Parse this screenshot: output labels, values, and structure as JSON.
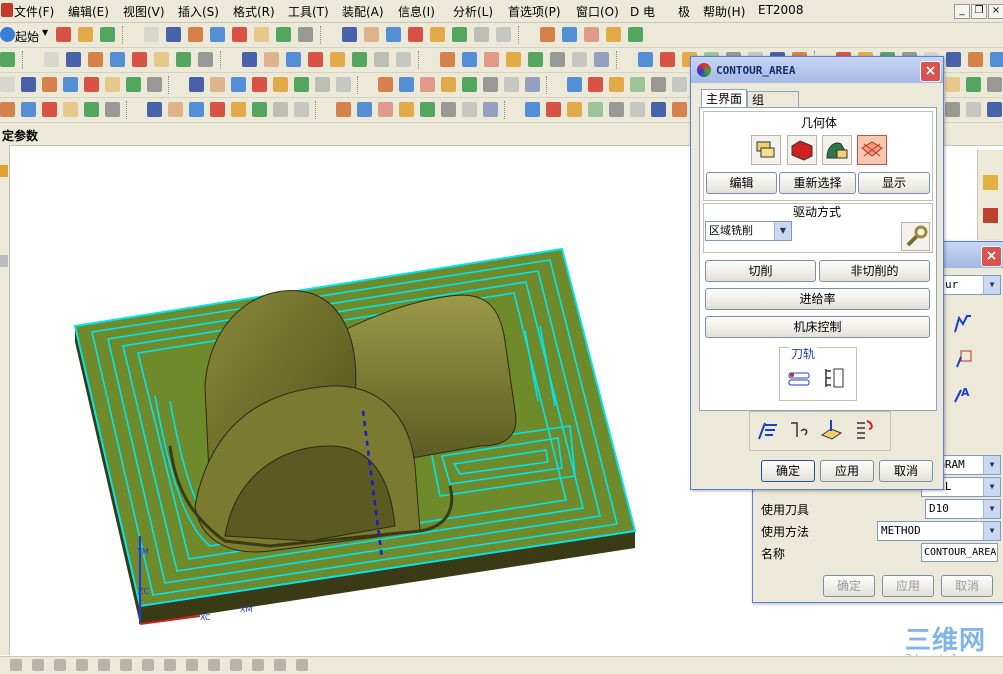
{
  "menu": {
    "items": [
      "文件(F)",
      "编辑(E)",
      "视图(V)",
      "插入(S)",
      "格式(R)",
      "工具(T)",
      "装配(A)",
      "信息(I)",
      "分析(L)",
      "首选项(P)",
      "窗口(O)",
      "D 电",
      "极",
      "帮助(H)",
      "ET2008"
    ]
  },
  "toolbar": {
    "start_label": "起始",
    "section_label": "定参数"
  },
  "contour_dialog": {
    "title": "CONTOUR_AREA",
    "tabs": [
      "主界面",
      "组"
    ],
    "geometry_label": "几何体",
    "edit_button": "编辑",
    "reselect_button": "重新选择",
    "display_button": "显示",
    "drive_label": "驱动方式",
    "drive_method": "区域铣削",
    "cut_button": "切削",
    "noncut_button": "非切削的",
    "feed_button": "进给率",
    "machine_button": "机床控制",
    "toolpath_label": "刀轨",
    "ok_button": "确定",
    "apply_button": "应用",
    "cancel_button": "取消"
  },
  "operation_dialog": {
    "top_select": "ur",
    "program_value": "ROGRAM",
    "geometry_value": "MILL",
    "tool_label": "使用刀具",
    "tool_value": "D10",
    "method_label": "使用方法",
    "method_value": "METHOD",
    "name_label": "名称",
    "name_value": "CONTOUR_AREA",
    "ok_button": "确定",
    "apply_button": "应用",
    "cancel_button": "取消"
  },
  "viewport": {
    "axis_xc": "XC",
    "axis_xm": "XM",
    "axis_ym": "YM",
    "axis_zc": "ZC"
  },
  "watermark": {
    "brand": "三维网",
    "url": "3dportal.cn"
  },
  "colors": {
    "toolpath": "#00e5ee",
    "part_olive": "#6b6b28",
    "base_green": "#6e8a2a",
    "title_blue": "#10306a",
    "watermark": "#7fb6e6"
  }
}
